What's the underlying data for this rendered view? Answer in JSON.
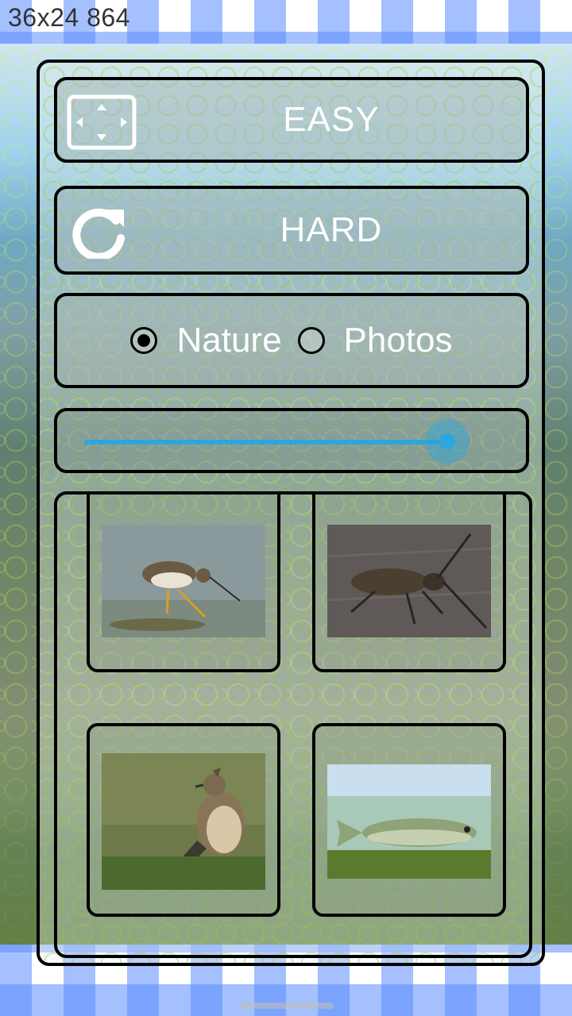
{
  "status_bar": {
    "text": "36x24 864"
  },
  "menu": {
    "easy_label": "EASY",
    "hard_label": "HARD",
    "easy_icon": "fullscreen-icon",
    "hard_icon": "refresh-icon"
  },
  "category": {
    "options": [
      {
        "label": "Nature",
        "selected": true
      },
      {
        "label": "Photos",
        "selected": false
      }
    ]
  },
  "slider": {
    "level": 0.97
  },
  "gallery": {
    "items": [
      {
        "subject": "sandpiper bird"
      },
      {
        "subject": "longhorn beetle"
      },
      {
        "subject": "crested lark"
      },
      {
        "subject": "fish"
      }
    ]
  },
  "colors": {
    "accent": "#2ba7dd",
    "text": "#ffffff",
    "border": "#000000"
  }
}
